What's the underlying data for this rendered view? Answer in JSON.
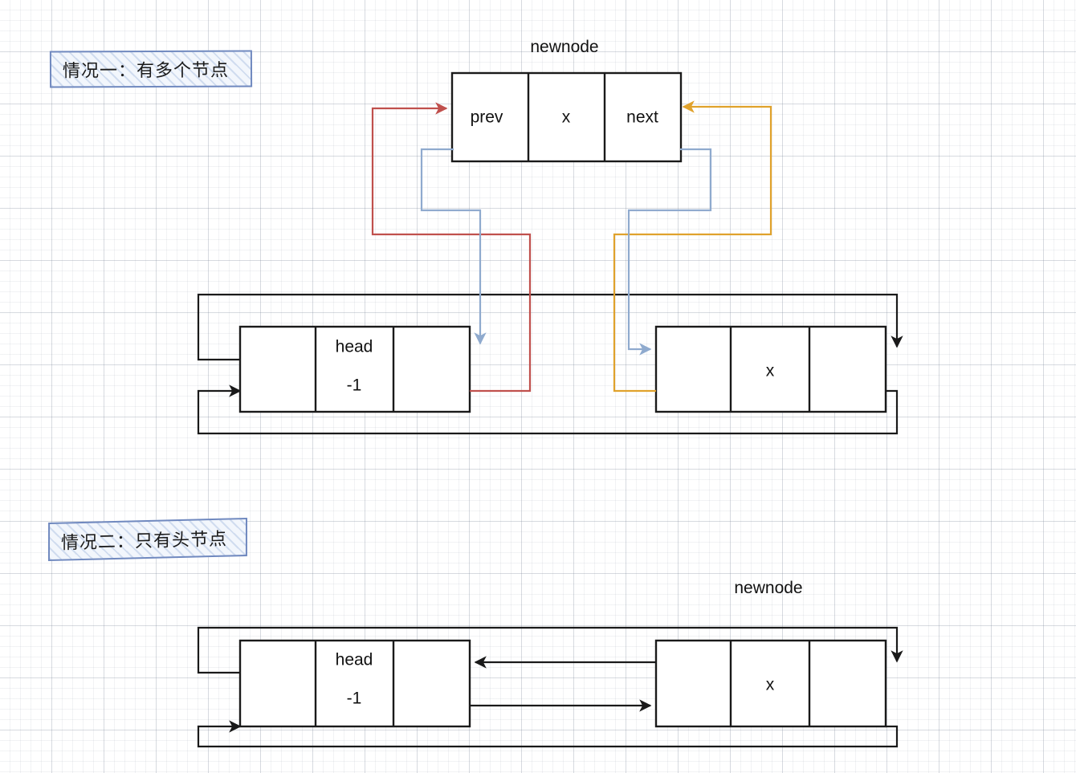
{
  "diagram": {
    "title_case_1": "情况一：有多个节点",
    "title_case_2": "情况二：只有头节点",
    "newnode_label_top": "newnode",
    "newnode_label_bottom": "newnode",
    "colors": {
      "prev_link": "#c0504d",
      "next_link": "#e0a22c",
      "newnode_link": "#8faace",
      "node_border": "#1a1a1a",
      "tag_border": "#7089bf",
      "tag_fill": "#f2f6fc"
    },
    "case1": {
      "newnode": {
        "cells": [
          "prev",
          "x",
          "next"
        ]
      },
      "head_node": {
        "cells": [
          "",
          "head\n-1",
          ""
        ],
        "value_line_1": "head",
        "value_line_2": "-1"
      },
      "tail_node": {
        "cells": [
          "",
          "x",
          ""
        ],
        "value": "x"
      }
    },
    "case2": {
      "head_node": {
        "value_line_1": "head",
        "value_line_2": "-1"
      },
      "new_node": {
        "value": "x"
      }
    }
  }
}
